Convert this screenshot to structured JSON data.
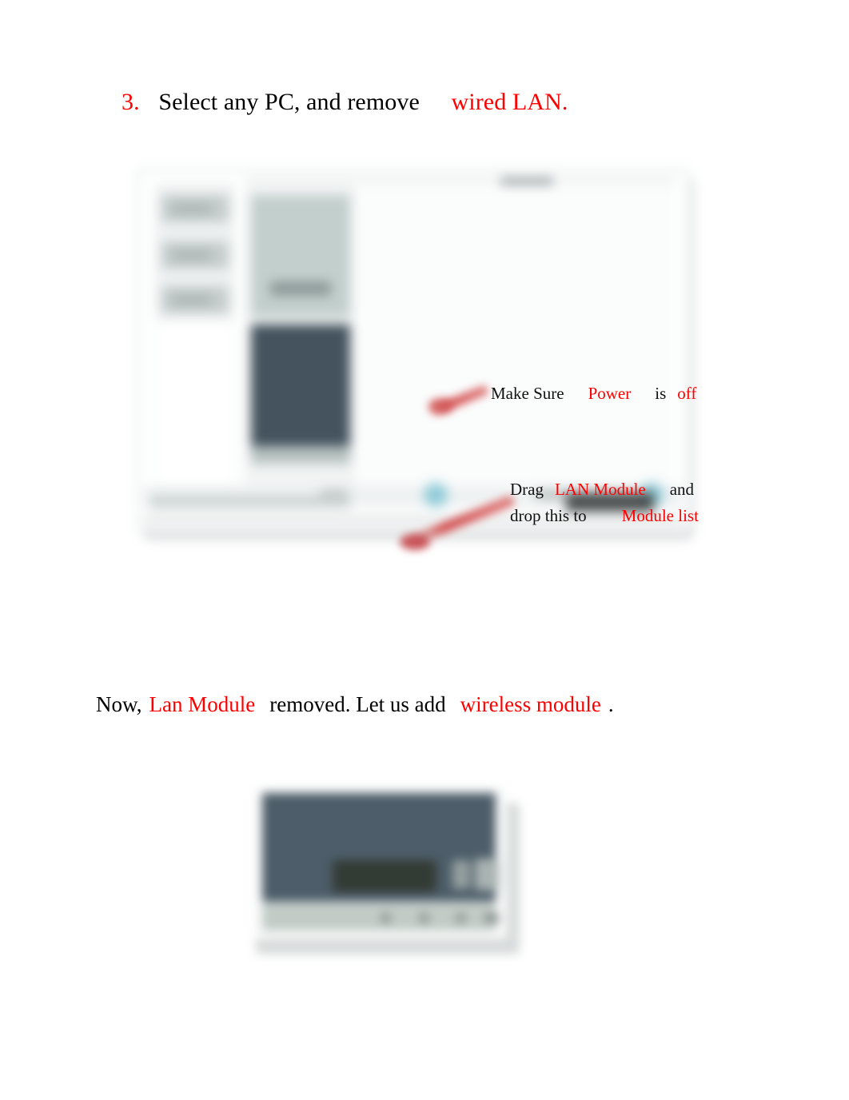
{
  "page": {
    "background": "#ffffff",
    "accent_red": "#ff0000"
  },
  "heading": {
    "number": "3.",
    "text_before": "Select any PC, and remove",
    "highlight": "wired LAN."
  },
  "figure_one": {
    "name": "packet-tracer-pc-physical-view",
    "annotations": {
      "power": {
        "prefix": "Make Sure",
        "highlight_1": "Power",
        "middle": "is",
        "highlight_2": "off"
      },
      "drag": {
        "prefix": "Drag",
        "highlight_1": "LAN Module",
        "suffix": "and",
        "line2_prefix": "drop this to",
        "line2_highlight": "Module list"
      }
    }
  },
  "paragraph_bottom": {
    "part1": "Now,",
    "highlight_1": "Lan Module",
    "part2": "removed. Let us add",
    "highlight_2": "wireless module",
    "part3": "."
  },
  "figure_two": {
    "name": "pc-chassis-module-bay-photo"
  }
}
